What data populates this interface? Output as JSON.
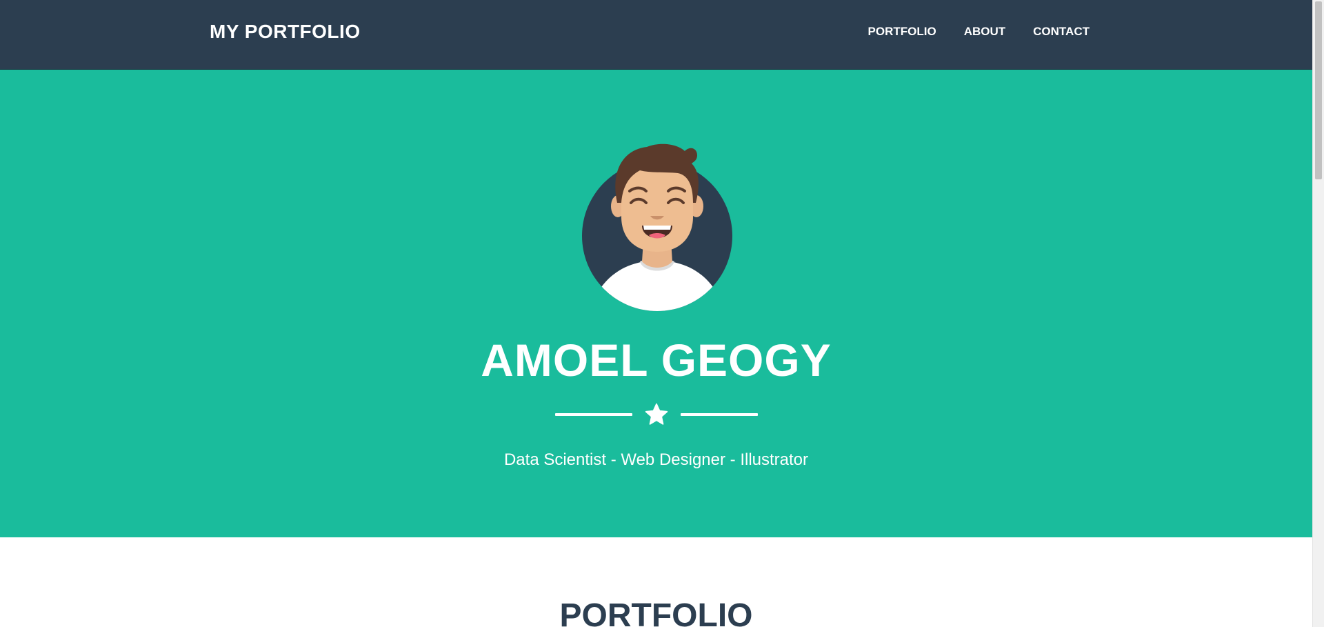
{
  "navbar": {
    "brand": "MY PORTFOLIO",
    "links": [
      {
        "label": "PORTFOLIO"
      },
      {
        "label": "ABOUT"
      },
      {
        "label": "CONTACT"
      }
    ]
  },
  "hero": {
    "avatar_icon": "avatar-icon",
    "name": "AMOEL GEOGY",
    "divider_icon": "star-icon",
    "tagline": "Data Scientist - Web Designer - Illustrator"
  },
  "portfolio_section": {
    "title": "PORTFOLIO"
  },
  "colors": {
    "navbar_bg": "#2c3e50",
    "hero_bg": "#1abc9c",
    "text_light": "#ffffff",
    "heading_dark": "#2c3e50"
  }
}
